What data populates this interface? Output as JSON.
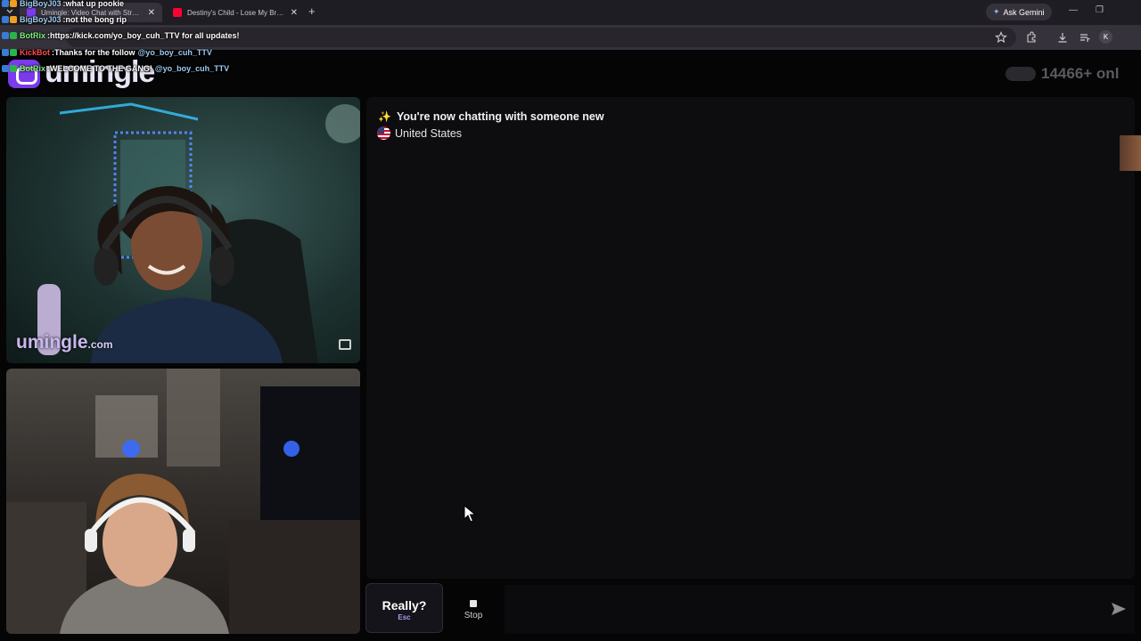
{
  "browser": {
    "tabs": [
      {
        "title": "Umingle: Video Chat with Strangers",
        "active": true,
        "favicon_color": "#7c3aed"
      },
      {
        "title": "Destiny's Child - Lose My Breath",
        "active": false,
        "favicon_color": "#ff0033"
      }
    ],
    "new_tab_icon": "plus-icon",
    "ask_gemini_label": "Ask Gemini",
    "profile_initial": "K"
  },
  "stream_chat": [
    {
      "user": "BigBoyJ03",
      "sep": " : ",
      "message": "what up pookie",
      "user_color": "#9ec9f0",
      "mention": ""
    },
    {
      "user": "BigBoyJ03",
      "sep": " : ",
      "message": "not the bong rip",
      "user_color": "#9ec9f0",
      "mention": ""
    },
    {
      "user": "BotRix",
      "sep": " : ",
      "message": "https://kick.com/yo_boy_cuh_TTV for all updates!",
      "user_color": "#7cf07c",
      "mention": ""
    },
    {
      "user": "KickBot",
      "sep": " : ",
      "message": "Thanks for the follow",
      "user_color": "#ff4a4a",
      "mention": "@yo_boy_cuh_TTV"
    },
    {
      "user": "BotRix",
      "sep": " : ",
      "message": "WELCOME TO THE GANG!",
      "user_color": "#7cf07c",
      "mention": "@yo_boy_cuh_TTV"
    }
  ],
  "site": {
    "logo_text": "umingle",
    "online_count": "14466+ onl"
  },
  "video": {
    "watermark_name": "umingle",
    "watermark_tld": ".com"
  },
  "chat": {
    "system_message": "You're now chatting with someone new",
    "country": "United States"
  },
  "controls": {
    "next_label": "Really?",
    "next_key": "Esc",
    "stop_label": "Stop",
    "message_placeholder": ""
  },
  "colors": {
    "brand": "#7c3aed",
    "panel_bg": "#0d0d10",
    "key_hint": "#a49df0"
  }
}
